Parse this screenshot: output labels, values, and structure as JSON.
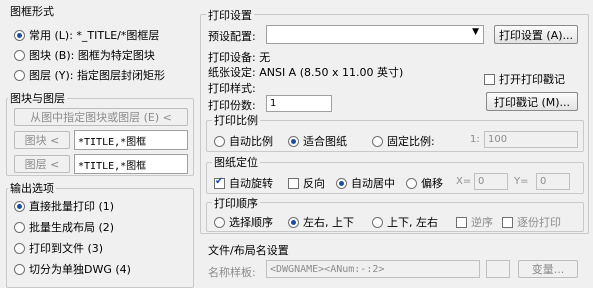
{
  "left": {
    "frame_group": {
      "title": "图框形式",
      "options": [
        {
          "label": "常用 (L): *_TITLE/*图框层",
          "checked": true
        },
        {
          "label": "图块 (B): 图框为特定图块",
          "checked": false
        },
        {
          "label": "图层 (Y): 指定图层封闭矩形",
          "checked": false
        }
      ]
    },
    "block_layer_group": {
      "title": "图块与图层",
      "pick_button": "从图中指定图块或图层 (E) <",
      "block_button": "图块 <",
      "block_value": "*TITLE,*图框",
      "layer_button": "图层 <",
      "layer_value": "*TITLE,*图框"
    },
    "output_group": {
      "title": "输出选项",
      "options": [
        {
          "label": "直接批量打印 (1)",
          "checked": true
        },
        {
          "label": "批量生成布局 (2)",
          "checked": false
        },
        {
          "label": "打印到文件 (3)",
          "checked": false
        },
        {
          "label": "切分为单独DWG (4)",
          "checked": false
        }
      ]
    }
  },
  "right": {
    "title": "打印设置",
    "preset_label": "预设配置:",
    "preset_value": "",
    "print_settings_button": "打印设置 (A)...",
    "device_label": "打印设备: 无",
    "paper_label": "纸张设定: ANSI A (8.50 x 11.00 英寸)",
    "style_label": "打印样式:",
    "open_stamp_label": "打开打印戳记",
    "copies_label": "打印份数:",
    "copies_value": "1",
    "stamp_button": "打印戳记 (M)...",
    "scale_group": {
      "title": "打印比例",
      "options": [
        "自动比例",
        "适合图纸",
        "固定比例:"
      ],
      "selected": 1,
      "ratio_prefix": "1:",
      "ratio_value": "100"
    },
    "position_group": {
      "title": "图纸定位",
      "auto_rotate": "自动旋转",
      "reverse": "反向",
      "auto_center": "自动居中",
      "offset": "偏移",
      "x_label": "X=",
      "x_value": "0",
      "y_label": "Y=",
      "y_value": "0"
    },
    "order_group": {
      "title": "打印顺序",
      "options": [
        "选择顺序",
        "左右, 上下",
        "上下, 左右"
      ],
      "selected": 1,
      "reverse_order": "逆序",
      "page_print": "逐份打印"
    },
    "filename_group": {
      "title": "文件/布局名设置",
      "template_label": "名称样板:",
      "template_value": "<DWGNAME><ANum:-:2>",
      "change_button": "变量..."
    }
  },
  "colors": {
    "accent": "#1a4fa0",
    "disabled": "#8c8c8c"
  }
}
